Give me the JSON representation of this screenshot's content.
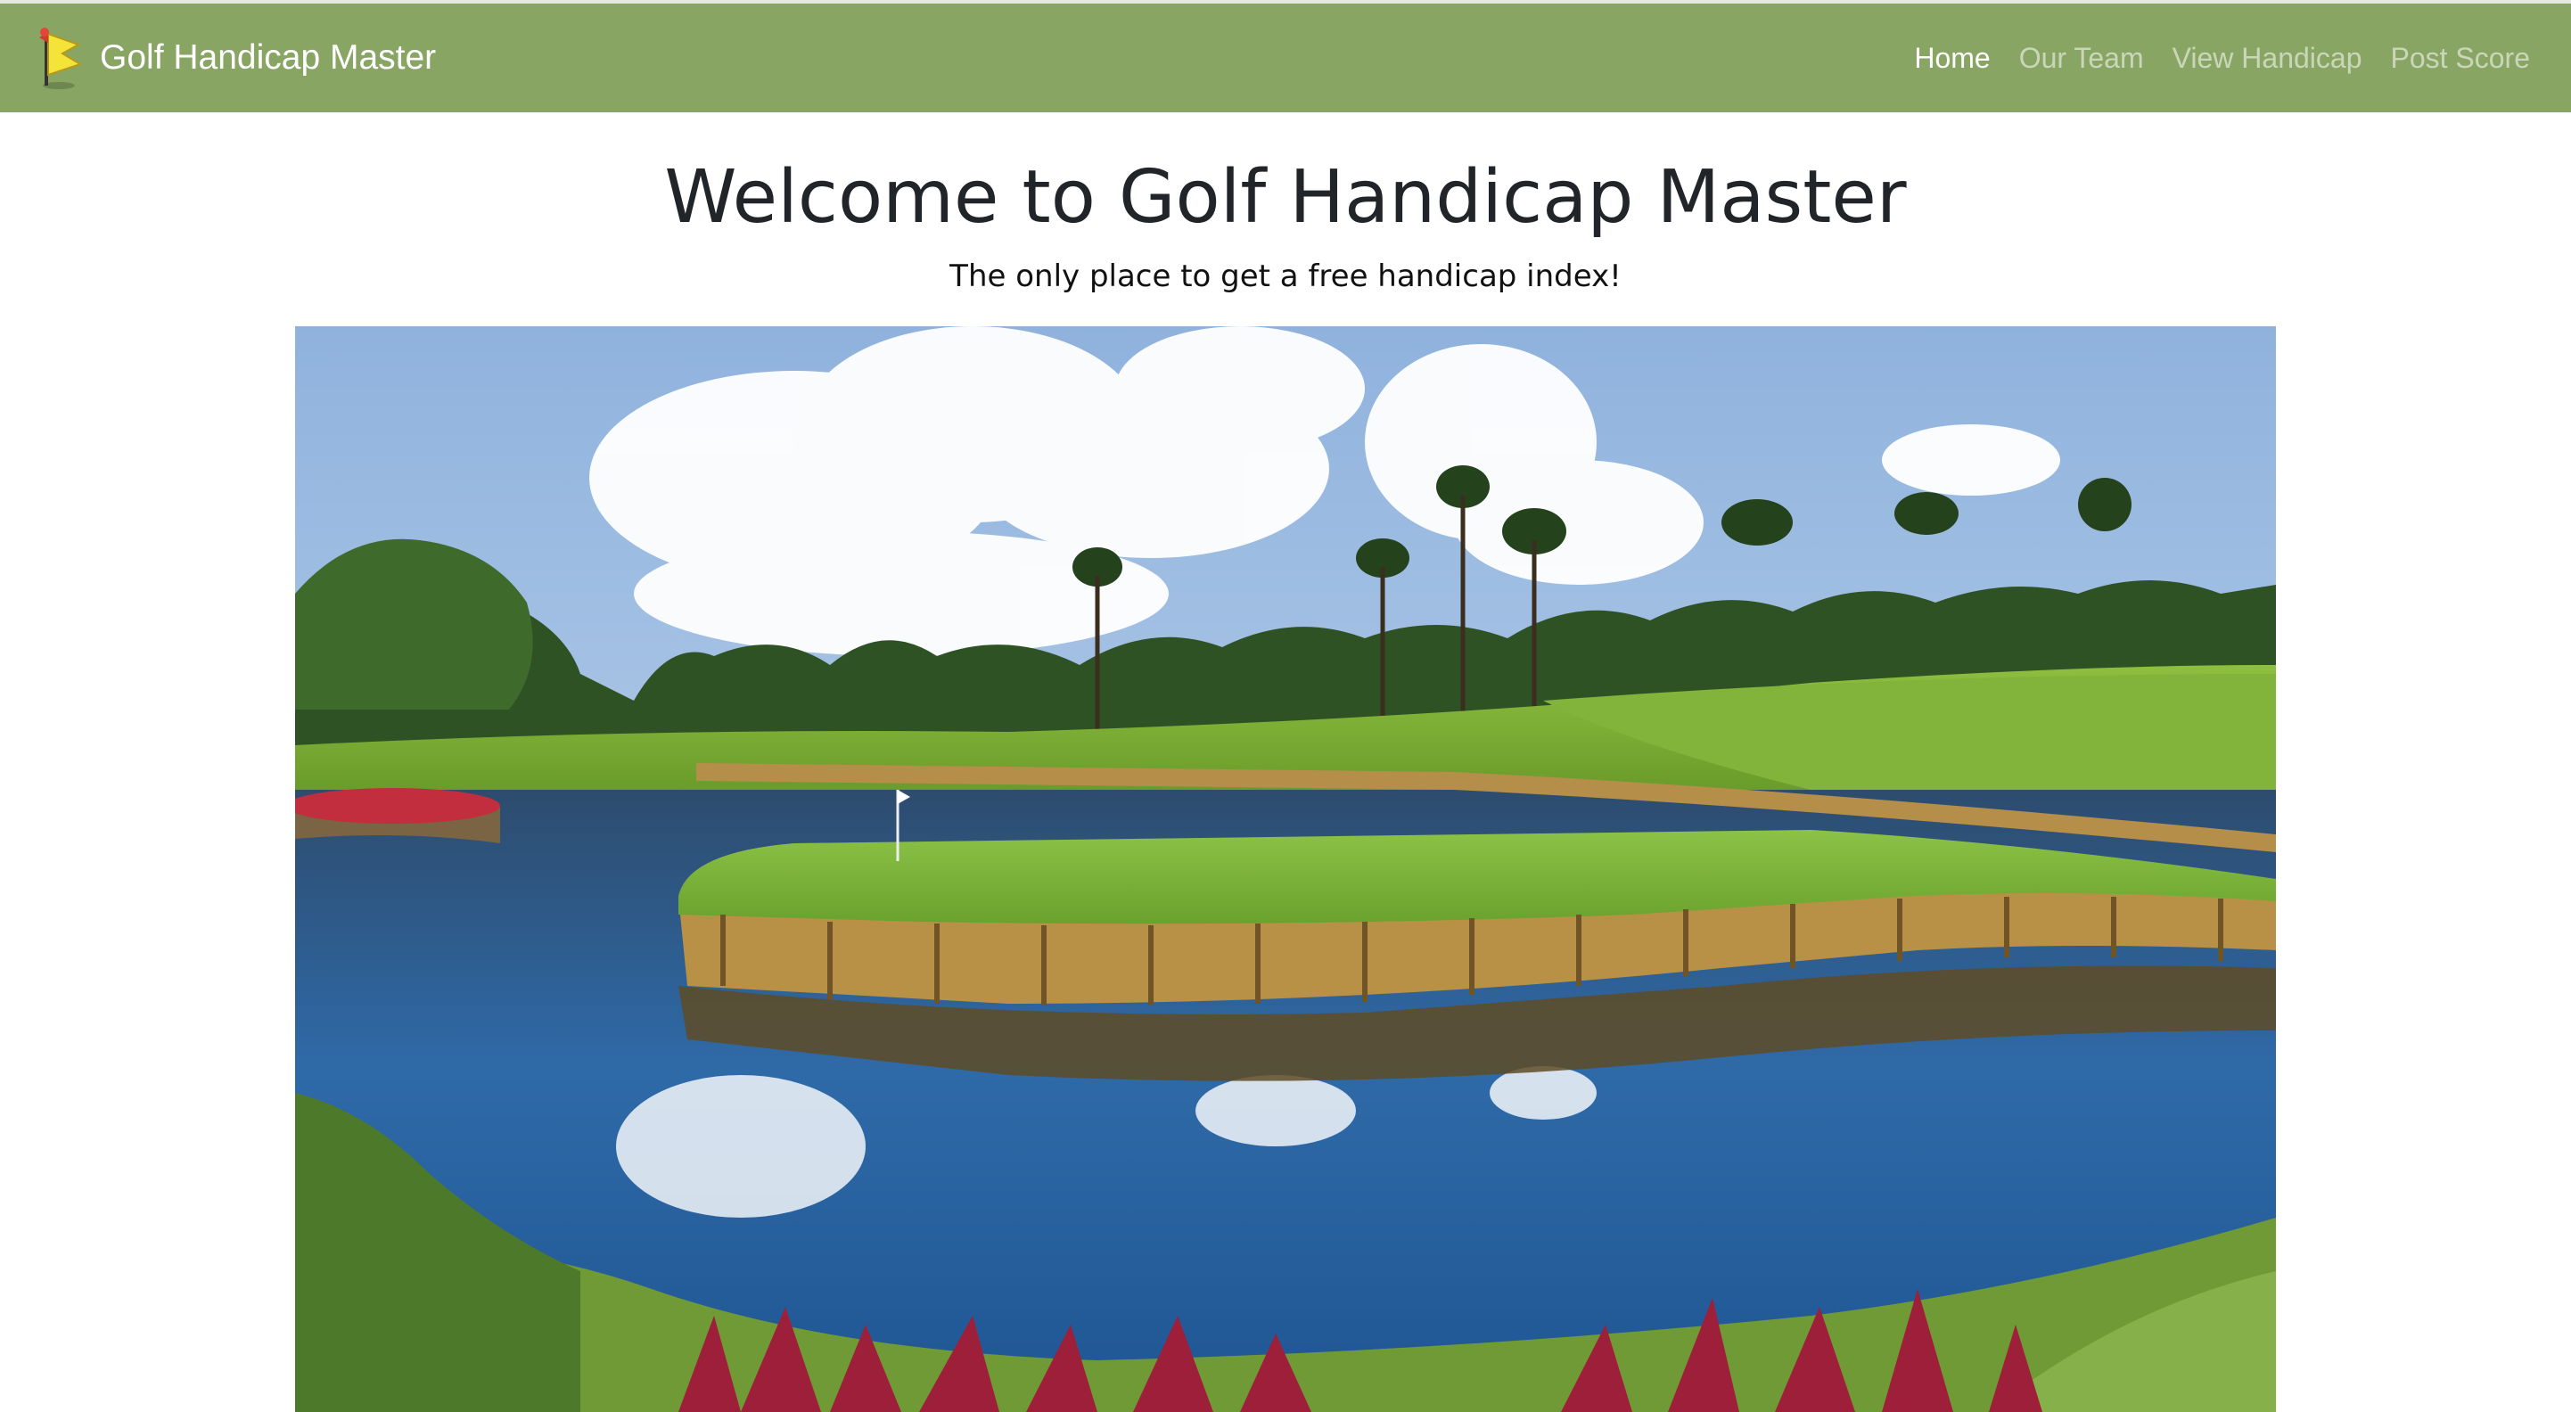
{
  "navbar": {
    "brand_label": "Golf Handicap Master",
    "logo_icon": "golf-flag-logo-icon",
    "bg_color": "#89a564",
    "links": [
      {
        "label": "Home",
        "active": true
      },
      {
        "label": "Our Team",
        "active": false
      },
      {
        "label": "View Handicap",
        "active": false
      },
      {
        "label": "Post Score",
        "active": false
      }
    ]
  },
  "hero": {
    "title": "Welcome to Golf Handicap Master",
    "subtitle": "The only place to get a free handicap index!",
    "image_icon": "golf-course-island-green-photo"
  }
}
